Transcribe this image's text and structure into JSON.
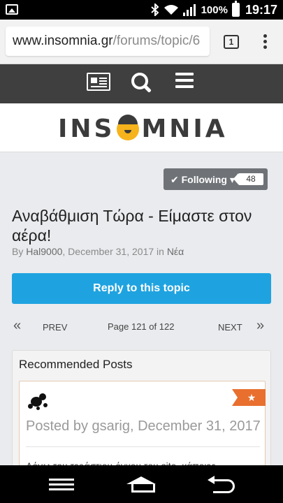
{
  "status_bar": {
    "battery_percent": "100%",
    "time": "19:17",
    "icons": [
      "image-icon",
      "bluetooth-icon",
      "wifi-icon",
      "signal-icon",
      "battery-icon"
    ]
  },
  "browser": {
    "url_host": "www.insomnia.gr",
    "url_path": "/forums/topic/6",
    "tab_count": "1",
    "icons": [
      "tabs-icon",
      "overflow-menu-icon"
    ]
  },
  "site_nav": {
    "icons": [
      "news-icon",
      "search-icon",
      "hamburger-menu-icon"
    ]
  },
  "logo": {
    "text_before": "INS",
    "text_after": "MNIA",
    "accent_color": "#f6b31b"
  },
  "follow": {
    "label": "✔ Following ▾",
    "count": "48"
  },
  "topic": {
    "title": "Αναβάθμιση Τώρα - Είμαστε στον αέρα!",
    "by_prefix": "By ",
    "author": "Hal9000",
    "date_part": ", December 31, 2017 in ",
    "forum": "Νέα"
  },
  "reply_button": {
    "label": "Reply to this topic",
    "color": "#1fa3e0"
  },
  "pagination": {
    "first_symbol": "«",
    "prev_label": "PREV",
    "page_info": "Page 121 of 122",
    "next_label": "NEXT",
    "last_symbol": "»"
  },
  "recommended": {
    "heading": "Recommended Posts",
    "post": {
      "star_symbol": "★",
      "posted_text": "Posted by gsarig, December 31, 2017",
      "snippet": "Λόγω του τεράστιου όγκου του site, κάποιες"
    }
  },
  "android_nav": {
    "icons": [
      "recent-apps-icon",
      "home-icon",
      "back-icon"
    ]
  }
}
